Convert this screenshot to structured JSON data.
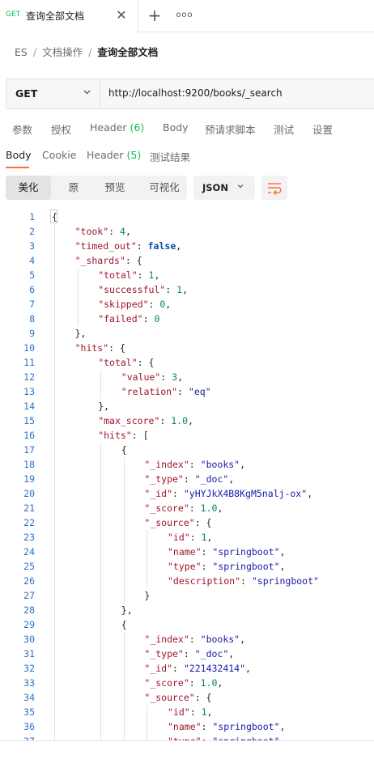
{
  "tab": {
    "method": "GET",
    "title": "查询全部文档",
    "close_glyph": "✕",
    "plus_glyph": "+",
    "more_glyph": "ooo"
  },
  "breadcrumb": [
    "ES",
    "文档操作",
    "查询全部文档"
  ],
  "request": {
    "method": "GET",
    "url": "http://localhost:9200/books/_search"
  },
  "request_tabs": [
    {
      "label": "参数"
    },
    {
      "label": "授权"
    },
    {
      "label": "Header",
      "count": "(6)"
    },
    {
      "label": "Body"
    },
    {
      "label": "预请求脚本"
    },
    {
      "label": "测试"
    },
    {
      "label": "设置"
    }
  ],
  "response_tabs": [
    {
      "label": "Body",
      "active": true
    },
    {
      "label": "Cookie"
    },
    {
      "label": "Header",
      "count": "(5)"
    },
    {
      "label": "测试结果"
    }
  ],
  "view_modes": [
    {
      "label": "美化",
      "active": true
    },
    {
      "label": "原"
    },
    {
      "label": "预览"
    },
    {
      "label": "可视化"
    }
  ],
  "format": "JSON",
  "colors": {
    "accent": "#ff6c37",
    "method_green": "#0cbb52"
  },
  "response_lines": [
    {
      "n": "1",
      "indent": 0,
      "t": [
        [
          "p",
          "{"
        ]
      ]
    },
    {
      "n": "2",
      "indent": 1,
      "t": [
        [
          "k",
          "\"took\""
        ],
        [
          "p",
          ": "
        ],
        [
          "n",
          "4"
        ],
        [
          "p",
          ","
        ]
      ]
    },
    {
      "n": "3",
      "indent": 1,
      "t": [
        [
          "k",
          "\"timed_out\""
        ],
        [
          "p",
          ": "
        ],
        [
          "b",
          "false"
        ],
        [
          "p",
          ","
        ]
      ]
    },
    {
      "n": "4",
      "indent": 1,
      "t": [
        [
          "k",
          "\"_shards\""
        ],
        [
          "p",
          ": {"
        ]
      ]
    },
    {
      "n": "5",
      "indent": 2,
      "t": [
        [
          "k",
          "\"total\""
        ],
        [
          "p",
          ": "
        ],
        [
          "n",
          "1"
        ],
        [
          "p",
          ","
        ]
      ]
    },
    {
      "n": "6",
      "indent": 2,
      "t": [
        [
          "k",
          "\"successful\""
        ],
        [
          "p",
          ": "
        ],
        [
          "n",
          "1"
        ],
        [
          "p",
          ","
        ]
      ]
    },
    {
      "n": "7",
      "indent": 2,
      "t": [
        [
          "k",
          "\"skipped\""
        ],
        [
          "p",
          ": "
        ],
        [
          "n",
          "0"
        ],
        [
          "p",
          ","
        ]
      ]
    },
    {
      "n": "8",
      "indent": 2,
      "t": [
        [
          "k",
          "\"failed\""
        ],
        [
          "p",
          ": "
        ],
        [
          "n",
          "0"
        ]
      ]
    },
    {
      "n": "9",
      "indent": 1,
      "t": [
        [
          "p",
          "},"
        ]
      ]
    },
    {
      "n": "10",
      "indent": 1,
      "t": [
        [
          "k",
          "\"hits\""
        ],
        [
          "p",
          ": {"
        ]
      ]
    },
    {
      "n": "11",
      "indent": 2,
      "t": [
        [
          "k",
          "\"total\""
        ],
        [
          "p",
          ": {"
        ]
      ]
    },
    {
      "n": "12",
      "indent": 3,
      "t": [
        [
          "k",
          "\"value\""
        ],
        [
          "p",
          ": "
        ],
        [
          "n",
          "3"
        ],
        [
          "p",
          ","
        ]
      ]
    },
    {
      "n": "13",
      "indent": 3,
      "t": [
        [
          "k",
          "\"relation\""
        ],
        [
          "p",
          ": "
        ],
        [
          "s",
          "\"eq\""
        ]
      ]
    },
    {
      "n": "14",
      "indent": 2,
      "t": [
        [
          "p",
          "},"
        ]
      ]
    },
    {
      "n": "15",
      "indent": 2,
      "t": [
        [
          "k",
          "\"max_score\""
        ],
        [
          "p",
          ": "
        ],
        [
          "n",
          "1.0"
        ],
        [
          "p",
          ","
        ]
      ]
    },
    {
      "n": "16",
      "indent": 2,
      "t": [
        [
          "k",
          "\"hits\""
        ],
        [
          "p",
          ": ["
        ]
      ]
    },
    {
      "n": "17",
      "indent": 3,
      "t": [
        [
          "p",
          "{"
        ]
      ]
    },
    {
      "n": "18",
      "indent": 4,
      "t": [
        [
          "k",
          "\"_index\""
        ],
        [
          "p",
          ": "
        ],
        [
          "s",
          "\"books\""
        ],
        [
          "p",
          ","
        ]
      ]
    },
    {
      "n": "19",
      "indent": 4,
      "t": [
        [
          "k",
          "\"_type\""
        ],
        [
          "p",
          ": "
        ],
        [
          "s",
          "\"_doc\""
        ],
        [
          "p",
          ","
        ]
      ]
    },
    {
      "n": "20",
      "indent": 4,
      "t": [
        [
          "k",
          "\"_id\""
        ],
        [
          "p",
          ": "
        ],
        [
          "s",
          "\"yHYJkX4B8KgM5nalj-ox\""
        ],
        [
          "p",
          ","
        ]
      ]
    },
    {
      "n": "21",
      "indent": 4,
      "t": [
        [
          "k",
          "\"_score\""
        ],
        [
          "p",
          ": "
        ],
        [
          "n",
          "1.0"
        ],
        [
          "p",
          ","
        ]
      ]
    },
    {
      "n": "22",
      "indent": 4,
      "t": [
        [
          "k",
          "\"_source\""
        ],
        [
          "p",
          ": {"
        ]
      ]
    },
    {
      "n": "23",
      "indent": 5,
      "t": [
        [
          "k",
          "\"id\""
        ],
        [
          "p",
          ": "
        ],
        [
          "n",
          "1"
        ],
        [
          "p",
          ","
        ]
      ]
    },
    {
      "n": "24",
      "indent": 5,
      "t": [
        [
          "k",
          "\"name\""
        ],
        [
          "p",
          ": "
        ],
        [
          "s",
          "\"springboot\""
        ],
        [
          "p",
          ","
        ]
      ]
    },
    {
      "n": "25",
      "indent": 5,
      "t": [
        [
          "k",
          "\"type\""
        ],
        [
          "p",
          ": "
        ],
        [
          "s",
          "\"springboot\""
        ],
        [
          "p",
          ","
        ]
      ]
    },
    {
      "n": "26",
      "indent": 5,
      "t": [
        [
          "k",
          "\"description\""
        ],
        [
          "p",
          ": "
        ],
        [
          "s",
          "\"springboot\""
        ]
      ]
    },
    {
      "n": "27",
      "indent": 4,
      "t": [
        [
          "p",
          "}"
        ]
      ]
    },
    {
      "n": "28",
      "indent": 3,
      "t": [
        [
          "p",
          "},"
        ]
      ]
    },
    {
      "n": "29",
      "indent": 3,
      "t": [
        [
          "p",
          "{"
        ]
      ]
    },
    {
      "n": "30",
      "indent": 4,
      "t": [
        [
          "k",
          "\"_index\""
        ],
        [
          "p",
          ": "
        ],
        [
          "s",
          "\"books\""
        ],
        [
          "p",
          ","
        ]
      ]
    },
    {
      "n": "31",
      "indent": 4,
      "t": [
        [
          "k",
          "\"_type\""
        ],
        [
          "p",
          ": "
        ],
        [
          "s",
          "\"_doc\""
        ],
        [
          "p",
          ","
        ]
      ]
    },
    {
      "n": "32",
      "indent": 4,
      "t": [
        [
          "k",
          "\"_id\""
        ],
        [
          "p",
          ": "
        ],
        [
          "s",
          "\"221432414\""
        ],
        [
          "p",
          ","
        ]
      ]
    },
    {
      "n": "33",
      "indent": 4,
      "t": [
        [
          "k",
          "\"_score\""
        ],
        [
          "p",
          ": "
        ],
        [
          "n",
          "1.0"
        ],
        [
          "p",
          ","
        ]
      ]
    },
    {
      "n": "34",
      "indent": 4,
      "t": [
        [
          "k",
          "\"_source\""
        ],
        [
          "p",
          ": {"
        ]
      ]
    },
    {
      "n": "35",
      "indent": 5,
      "t": [
        [
          "k",
          "\"id\""
        ],
        [
          "p",
          ": "
        ],
        [
          "n",
          "1"
        ],
        [
          "p",
          ","
        ]
      ]
    },
    {
      "n": "36",
      "indent": 5,
      "t": [
        [
          "k",
          "\"name\""
        ],
        [
          "p",
          ": "
        ],
        [
          "s",
          "\"springboot\""
        ],
        [
          "p",
          ","
        ]
      ]
    },
    {
      "n": "37",
      "indent": 5,
      "t": [
        [
          "k",
          "\"type\""
        ],
        [
          "p",
          ": "
        ],
        [
          "s",
          "\"springboot\""
        ],
        [
          "p",
          ","
        ]
      ]
    }
  ]
}
